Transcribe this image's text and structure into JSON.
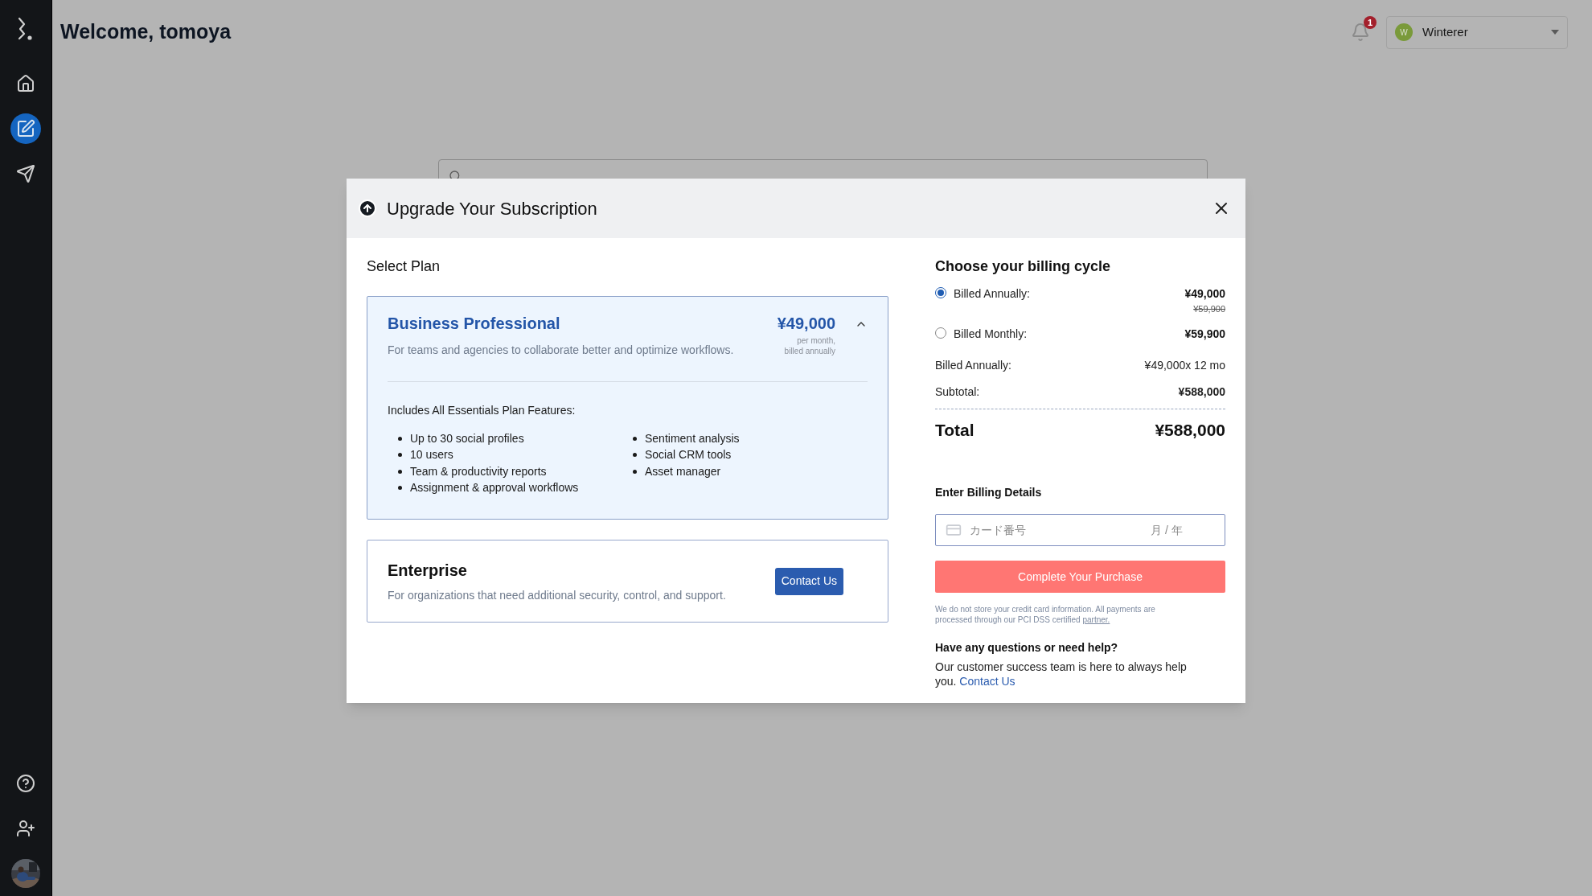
{
  "sidebar": {
    "items": [
      {
        "selected": false
      },
      {
        "selected": true
      },
      {
        "selected": false
      }
    ]
  },
  "header": {
    "title": "Welcome, tomoya",
    "notification_count": "1",
    "account": {
      "initial": "W",
      "name": "Winterer",
      "color": "#7a9a3a"
    }
  },
  "modal": {
    "title": "Upgrade Your Subscription",
    "select_plan_label": "Select Plan",
    "plans": [
      {
        "kind": "detailed",
        "name": "Business Professional",
        "description": "For teams and agencies to collaborate better and optimize workflows.",
        "price": "¥49,000",
        "price_note": [
          "per month,",
          "billed annually"
        ],
        "selected": true,
        "expanded": true,
        "features_title": "Includes All Essentials Plan Features:",
        "features": [
          [
            "Up to 30 social profiles",
            "10 users",
            "Team & productivity reports",
            "Assignment & approval workflows"
          ],
          [
            "Sentiment analysis",
            "Social CRM tools",
            "Asset manager"
          ]
        ]
      },
      {
        "kind": "contact",
        "name": "Enterprise",
        "description": "For organizations that need additional security, control, and support.",
        "button": "Contact Us",
        "selected": false
      }
    ],
    "billing": {
      "title": "Choose your billing cycle",
      "options": [
        {
          "label": "Billed Annually:",
          "price": "¥49,000",
          "old_price": "¥59,900",
          "selected": true
        },
        {
          "label": "Billed Monthly:",
          "price": "¥59,900",
          "selected": false
        }
      ],
      "summary": [
        {
          "label": "Billed Annually:",
          "value": "¥49,000x 12 mo",
          "bold": false
        },
        {
          "label": "Subtotal:",
          "value": "¥588,000",
          "bold": true
        }
      ],
      "total_label": "Total",
      "total_value": "¥588,000",
      "details_title": "Enter Billing Details",
      "card_placeholder": "カード番号",
      "expiry_placeholder": "月 / 年",
      "purchase_button": "Complete Your Purchase",
      "disclaimer": "We do not store your credit card information. All payments are processed through our PCI DSS certified",
      "disclaimer_link": "partner.",
      "help_title": "Have any questions or need help?",
      "help_text": "Our customer success team is here to always help you.",
      "help_link": "Contact Us"
    }
  }
}
